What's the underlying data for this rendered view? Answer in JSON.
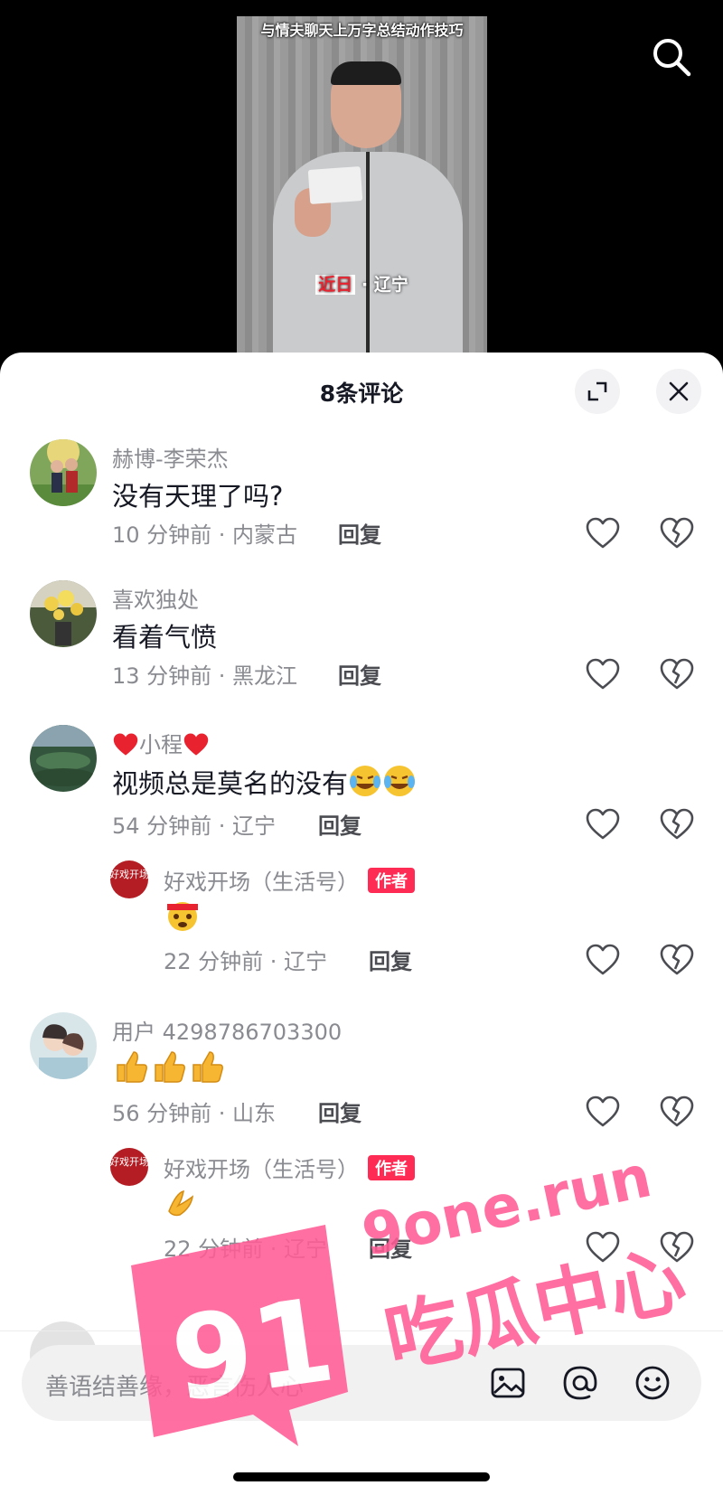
{
  "video": {
    "caption": "与情夫聊天上万字总结动作技巧",
    "location_date": "近日",
    "location_sep": "·",
    "location_place": "辽宁"
  },
  "header": {
    "title": "8条评论"
  },
  "comments": [
    {
      "name": "赫博-李荣杰",
      "text": "没有天理了吗?",
      "time": "10 分钟前 · 内蒙古",
      "reply": "回复"
    },
    {
      "name": "喜欢独处",
      "text": "看着气愤",
      "time": "13 分钟前 · 黑龙江",
      "reply": "回复"
    },
    {
      "name": "小程",
      "text": "视频总是莫名的没有",
      "time": "54 分钟前 · 辽宁",
      "reply": "回复",
      "reply_comment": {
        "name": "好戏开场（生活号）",
        "badge": "作者",
        "time": "22 分钟前 · 辽宁",
        "reply": "回复"
      }
    },
    {
      "name": "用户 4298786703300",
      "time": "56 分钟前 · 山东",
      "reply": "回复",
      "reply_comment": {
        "name": "好戏开场（生活号）",
        "badge": "作者",
        "time": "22 分钟前 · 辽宁",
        "reply": "回复"
      }
    }
  ],
  "input": {
    "placeholder": "善语结善缘，恶言伤人心"
  },
  "author_avatar_text": "好戏开场",
  "watermark": {
    "number": "91",
    "domain": "9one.run",
    "brand": "吃瓜中心"
  },
  "colors": {
    "accent": "#fe2c55",
    "watermark": "#ff5c95"
  }
}
